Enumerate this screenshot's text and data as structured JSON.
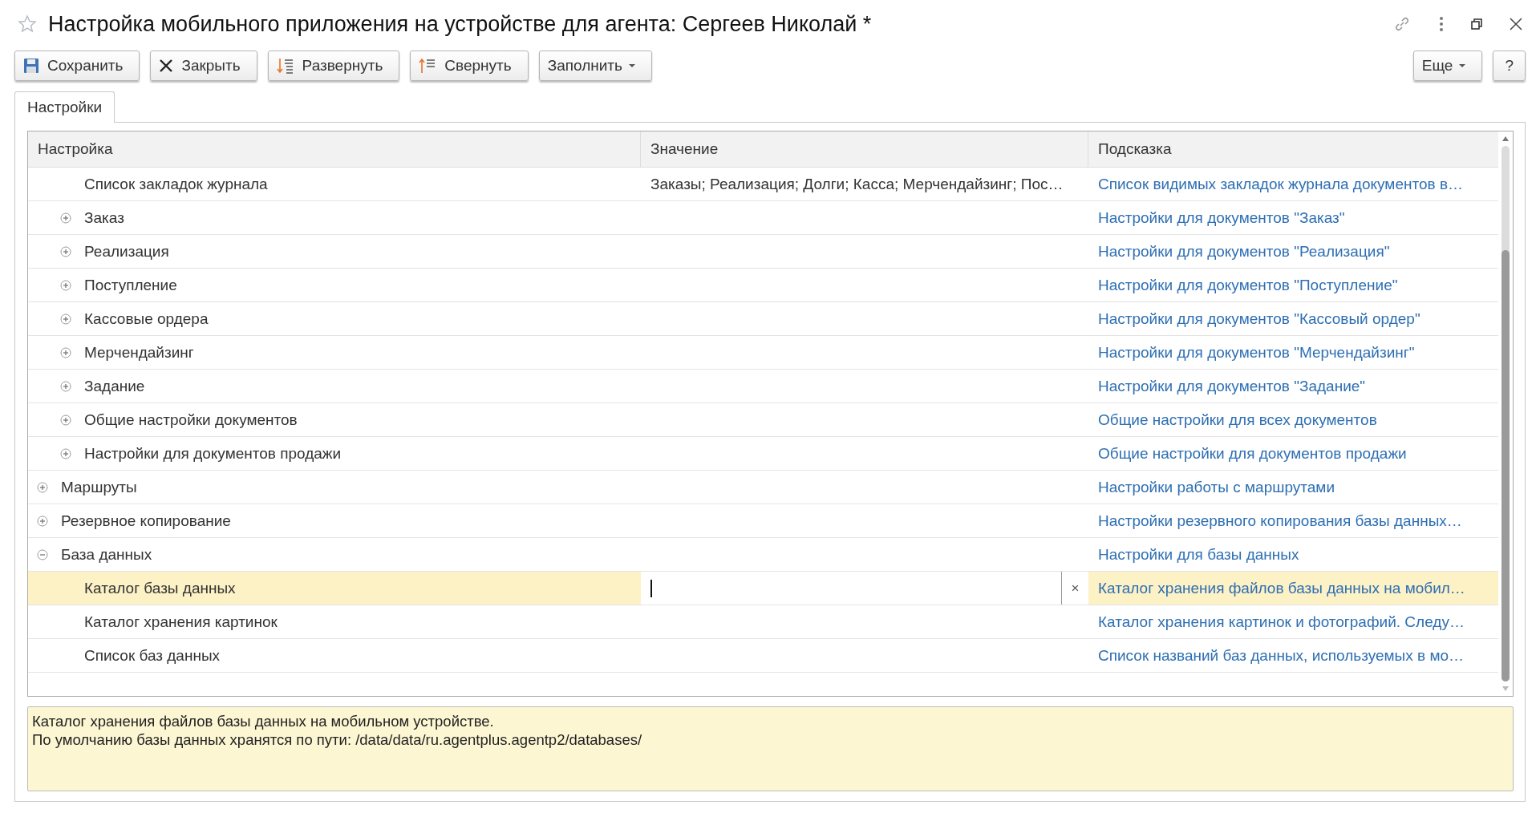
{
  "window": {
    "title": "Настройка мобильного приложения на устройстве для агента: Сергеев Николай *"
  },
  "toolbar": {
    "buttons": [
      {
        "kind": "save",
        "label": "Сохранить"
      },
      {
        "kind": "close",
        "label": "Закрыть"
      },
      {
        "kind": "expand",
        "label": "Развернуть"
      },
      {
        "kind": "collapse",
        "label": "Свернуть"
      },
      {
        "kind": "dropdown",
        "label": "Заполнить"
      }
    ],
    "right_buttons": [
      {
        "kind": "dropdown",
        "label": "Еще"
      },
      {
        "kind": "plain",
        "label": "?"
      }
    ]
  },
  "tabs": [
    {
      "label": "Настройки",
      "selected": true
    }
  ],
  "table": {
    "columns": [
      "Настройка",
      "Значение",
      "Подсказка"
    ],
    "rows_of_scrolled_parent": [
      {
        "name": "Список закладок журнала",
        "value": "Заказы; Реализация; Долги; Касса; Мерчендайзинг; Пос…",
        "hint": "Список видимых закладок журнала документов в…",
        "selected": false
      },
      {
        "name": "Заказ",
        "hint": "Настройки для документов \"Заказ\"",
        "expanded": false,
        "selected": false
      },
      {
        "name": "Реализация",
        "hint": "Настройки для документов \"Реализация\"",
        "expanded": false,
        "selected": false
      },
      {
        "name": "Поступление",
        "hint": "Настройки для документов \"Поступление\"",
        "expanded": false,
        "selected": false
      },
      {
        "name": "Кассовые ордера",
        "hint": "Настройки для документов \"Кассовый ордер\"",
        "expanded": false,
        "selected": false
      },
      {
        "name": "Мерчендайзинг",
        "hint": "Настройки для документов \"Мерчендайзинг\"",
        "expanded": false,
        "selected": false
      },
      {
        "name": "Задание",
        "hint": "Настройки для документов \"Задание\"",
        "expanded": false,
        "selected": false
      },
      {
        "name": "Общие настройки документов",
        "hint": "Общие настройки для всех документов",
        "expanded": false,
        "selected": false
      },
      {
        "name": "Настройки для документов продажи",
        "hint": "Общие настройки для документов продажи",
        "expanded": false,
        "selected": false
      }
    ],
    "rows": [
      {
        "name": "Маршруты",
        "hint": "Настройки работы с маршрутами",
        "expanded": false,
        "selected": false
      },
      {
        "name": "Резервное копирование",
        "hint": "Настройки резервного копирования базы данных…",
        "expanded": false,
        "selected": false
      },
      {
        "name": "База данных",
        "hint": "Настройки для базы данных",
        "expanded": true,
        "selected": false,
        "children": [
          {
            "name": "Каталог базы данных",
            "hint": "Каталог хранения файлов базы данных на мобил…",
            "selected": true,
            "editing": true,
            "clear_button": "×"
          },
          {
            "name": "Каталог хранения картинок",
            "hint": "Каталог хранения картинок и фотографий. Следу…",
            "selected": false
          },
          {
            "name": "Список баз данных",
            "hint": "Список названий баз данных, используемых в мо…",
            "selected": false
          }
        ]
      }
    ]
  },
  "description": [
    "Каталог хранения файлов базы данных на мобильном устройстве.",
    "По умолчанию базы данных хранятся по пути: /data/data/ru.agentplus.agentp2/databases/"
  ]
}
